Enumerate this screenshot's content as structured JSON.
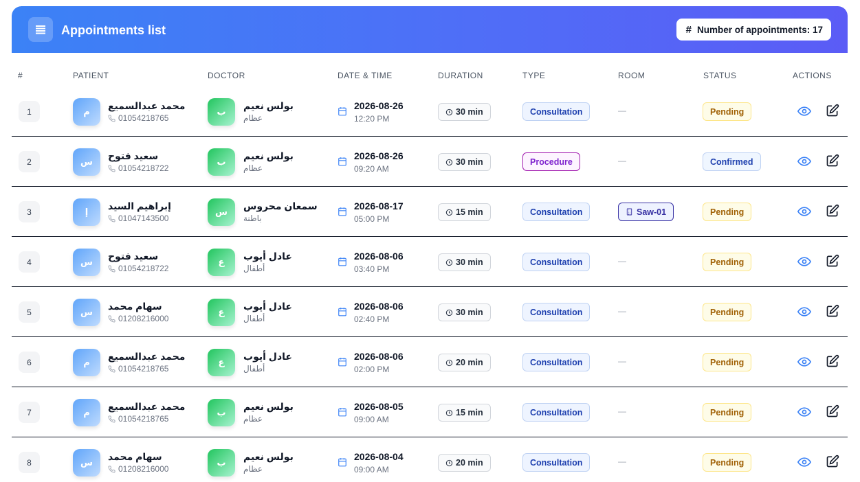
{
  "header": {
    "title": "Appointments list",
    "count_label": "Number of appointments: 17"
  },
  "columns": [
    "#",
    "PATIENT",
    "DOCTOR",
    "DATE & TIME",
    "DURATION",
    "TYPE",
    "ROOM",
    "STATUS",
    "ACTIONS"
  ],
  "room_empty": "—",
  "colors": {
    "header_start": "#3b82f6",
    "header_end": "#5b5cf6",
    "patient_avatar": "#60a5fa",
    "doctor_avatar": "#22c55e"
  },
  "rows": [
    {
      "num": "1",
      "patient_initial": "م",
      "patient": "محمد عبدالسميع",
      "phone": "01054218765",
      "doctor_initial": "ب",
      "doctor": "بولس نعيم",
      "specialty": "عظام",
      "date": "2026-08-26",
      "time": "12:20 PM",
      "duration": "30 min",
      "type": "Consultation",
      "type_kind": "consult",
      "room": "",
      "status": "Pending",
      "status_kind": "pending"
    },
    {
      "num": "2",
      "patient_initial": "س",
      "patient": "سعيد فتوح",
      "phone": "01054218722",
      "doctor_initial": "ب",
      "doctor": "بولس نعيم",
      "specialty": "عظام",
      "date": "2026-08-26",
      "time": "09:20 AM",
      "duration": "30 min",
      "type": "Procedure",
      "type_kind": "proc",
      "room": "",
      "status": "Confirmed",
      "status_kind": "confirmed"
    },
    {
      "num": "3",
      "patient_initial": "إ",
      "patient": "إبراهيم السيد",
      "phone": "01047143500",
      "doctor_initial": "س",
      "doctor": "سمعان محروس",
      "specialty": "باطنة",
      "date": "2026-08-17",
      "time": "05:00 PM",
      "duration": "15 min",
      "type": "Consultation",
      "type_kind": "consult",
      "room": "Saw-01",
      "status": "Pending",
      "status_kind": "pending"
    },
    {
      "num": "4",
      "patient_initial": "س",
      "patient": "سعيد فتوح",
      "phone": "01054218722",
      "doctor_initial": "ع",
      "doctor": "عادل أيوب",
      "specialty": "أطفال",
      "date": "2026-08-06",
      "time": "03:40 PM",
      "duration": "30 min",
      "type": "Consultation",
      "type_kind": "consult",
      "room": "",
      "status": "Pending",
      "status_kind": "pending"
    },
    {
      "num": "5",
      "patient_initial": "س",
      "patient": "سهام محمد",
      "phone": "01208216000",
      "doctor_initial": "ع",
      "doctor": "عادل أيوب",
      "specialty": "أطفال",
      "date": "2026-08-06",
      "time": "02:40 PM",
      "duration": "30 min",
      "type": "Consultation",
      "type_kind": "consult",
      "room": "",
      "status": "Pending",
      "status_kind": "pending"
    },
    {
      "num": "6",
      "patient_initial": "م",
      "patient": "محمد عبدالسميع",
      "phone": "01054218765",
      "doctor_initial": "ع",
      "doctor": "عادل أيوب",
      "specialty": "أطفال",
      "date": "2026-08-06",
      "time": "02:00 PM",
      "duration": "20 min",
      "type": "Consultation",
      "type_kind": "consult",
      "room": "",
      "status": "Pending",
      "status_kind": "pending"
    },
    {
      "num": "7",
      "patient_initial": "م",
      "patient": "محمد عبدالسميع",
      "phone": "01054218765",
      "doctor_initial": "ب",
      "doctor": "بولس نعيم",
      "specialty": "عظام",
      "date": "2026-08-05",
      "time": "09:00 AM",
      "duration": "15 min",
      "type": "Consultation",
      "type_kind": "consult",
      "room": "",
      "status": "Pending",
      "status_kind": "pending"
    },
    {
      "num": "8",
      "patient_initial": "س",
      "patient": "سهام محمد",
      "phone": "01208216000",
      "doctor_initial": "ب",
      "doctor": "بولس نعيم",
      "specialty": "عظام",
      "date": "2026-08-04",
      "time": "09:00 AM",
      "duration": "20 min",
      "type": "Consultation",
      "type_kind": "consult",
      "room": "",
      "status": "Pending",
      "status_kind": "pending"
    }
  ]
}
